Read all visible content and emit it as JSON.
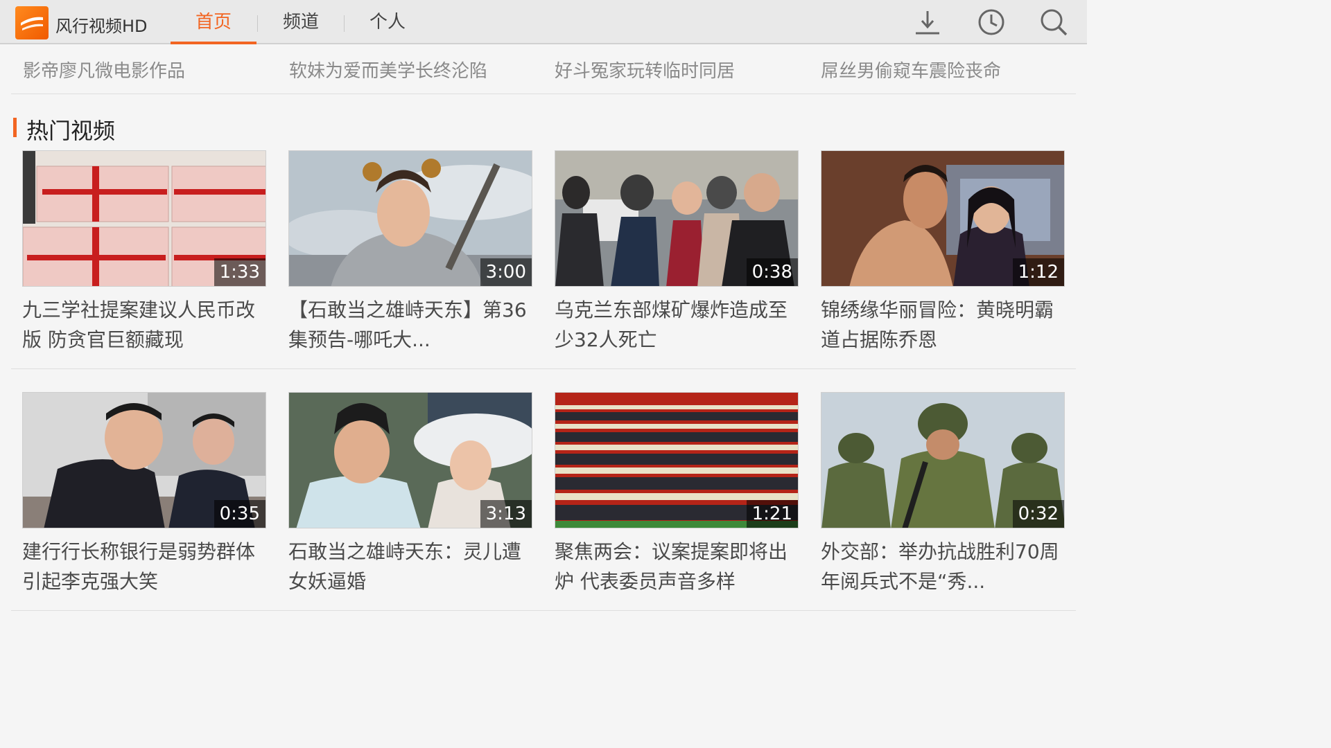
{
  "app": {
    "name": "风行视频HD"
  },
  "tabs": [
    {
      "label": "首页",
      "active": true
    },
    {
      "label": "频道",
      "active": false
    },
    {
      "label": "个人",
      "active": false
    }
  ],
  "header_icons": [
    "download-icon",
    "history-icon",
    "search-icon"
  ],
  "top_links": [
    "影帝廖凡微电影作品",
    "软妹为爱而美学长终沦陷",
    "好斗冤家玩转临时同居",
    "屌丝男偷窥车震险丧命"
  ],
  "section": {
    "title": "热门视频"
  },
  "videos": [
    {
      "duration": "1:33",
      "title": "九三学社提案建议人民币改版 防贪官巨额藏现"
    },
    {
      "duration": "3:00",
      "title": "【石敢当之雄峙天东】第36集预告-哪吒大..."
    },
    {
      "duration": "0:38",
      "title": "乌克兰东部煤矿爆炸造成至少32人死亡"
    },
    {
      "duration": "1:12",
      "title": "锦绣缘华丽冒险：黄晓明霸道占据陈乔恩"
    },
    {
      "duration": "0:35",
      "title": "建行行长称银行是弱势群体 引起李克强大笑"
    },
    {
      "duration": "3:13",
      "title": "石敢当之雄峙天东：灵儿遭女妖逼婚"
    },
    {
      "duration": "1:21",
      "title": "聚焦两会：议案提案即将出炉 代表委员声音多样"
    },
    {
      "duration": "0:32",
      "title": "外交部：举办抗战胜利70周年阅兵式不是“秀..."
    }
  ],
  "colors": {
    "accent": "#f26522",
    "topbar": "#e9e9e9"
  }
}
